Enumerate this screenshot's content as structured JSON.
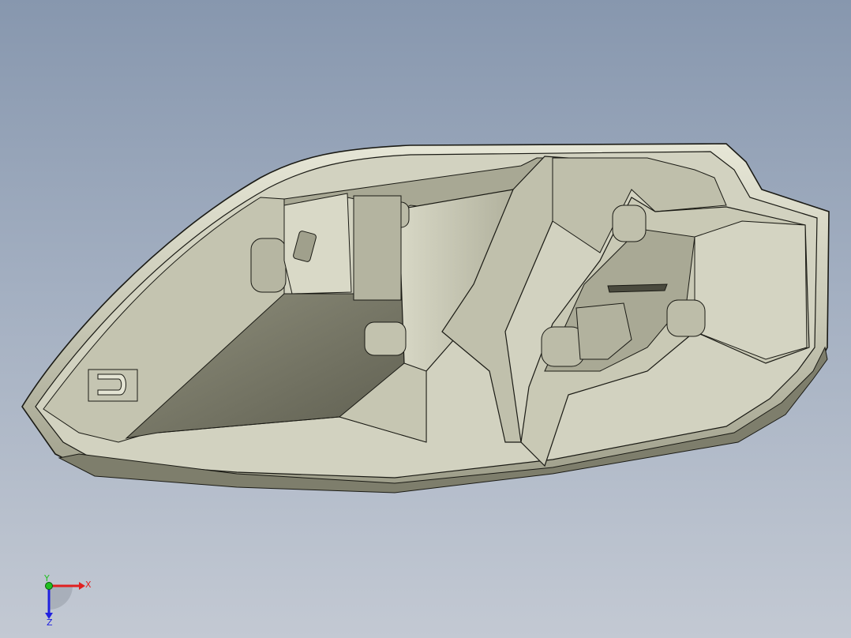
{
  "viewport": {
    "background_top": "#8797ae",
    "background_bottom": "#c3c9d3",
    "model_color": "#c8c8b4",
    "edge_color": "#1a1a14"
  },
  "triad": {
    "x_label": "X",
    "y_label": "Y",
    "z_label": "Z",
    "x_color": "#e02020",
    "y_color": "#20c020",
    "z_color": "#2020e0"
  }
}
